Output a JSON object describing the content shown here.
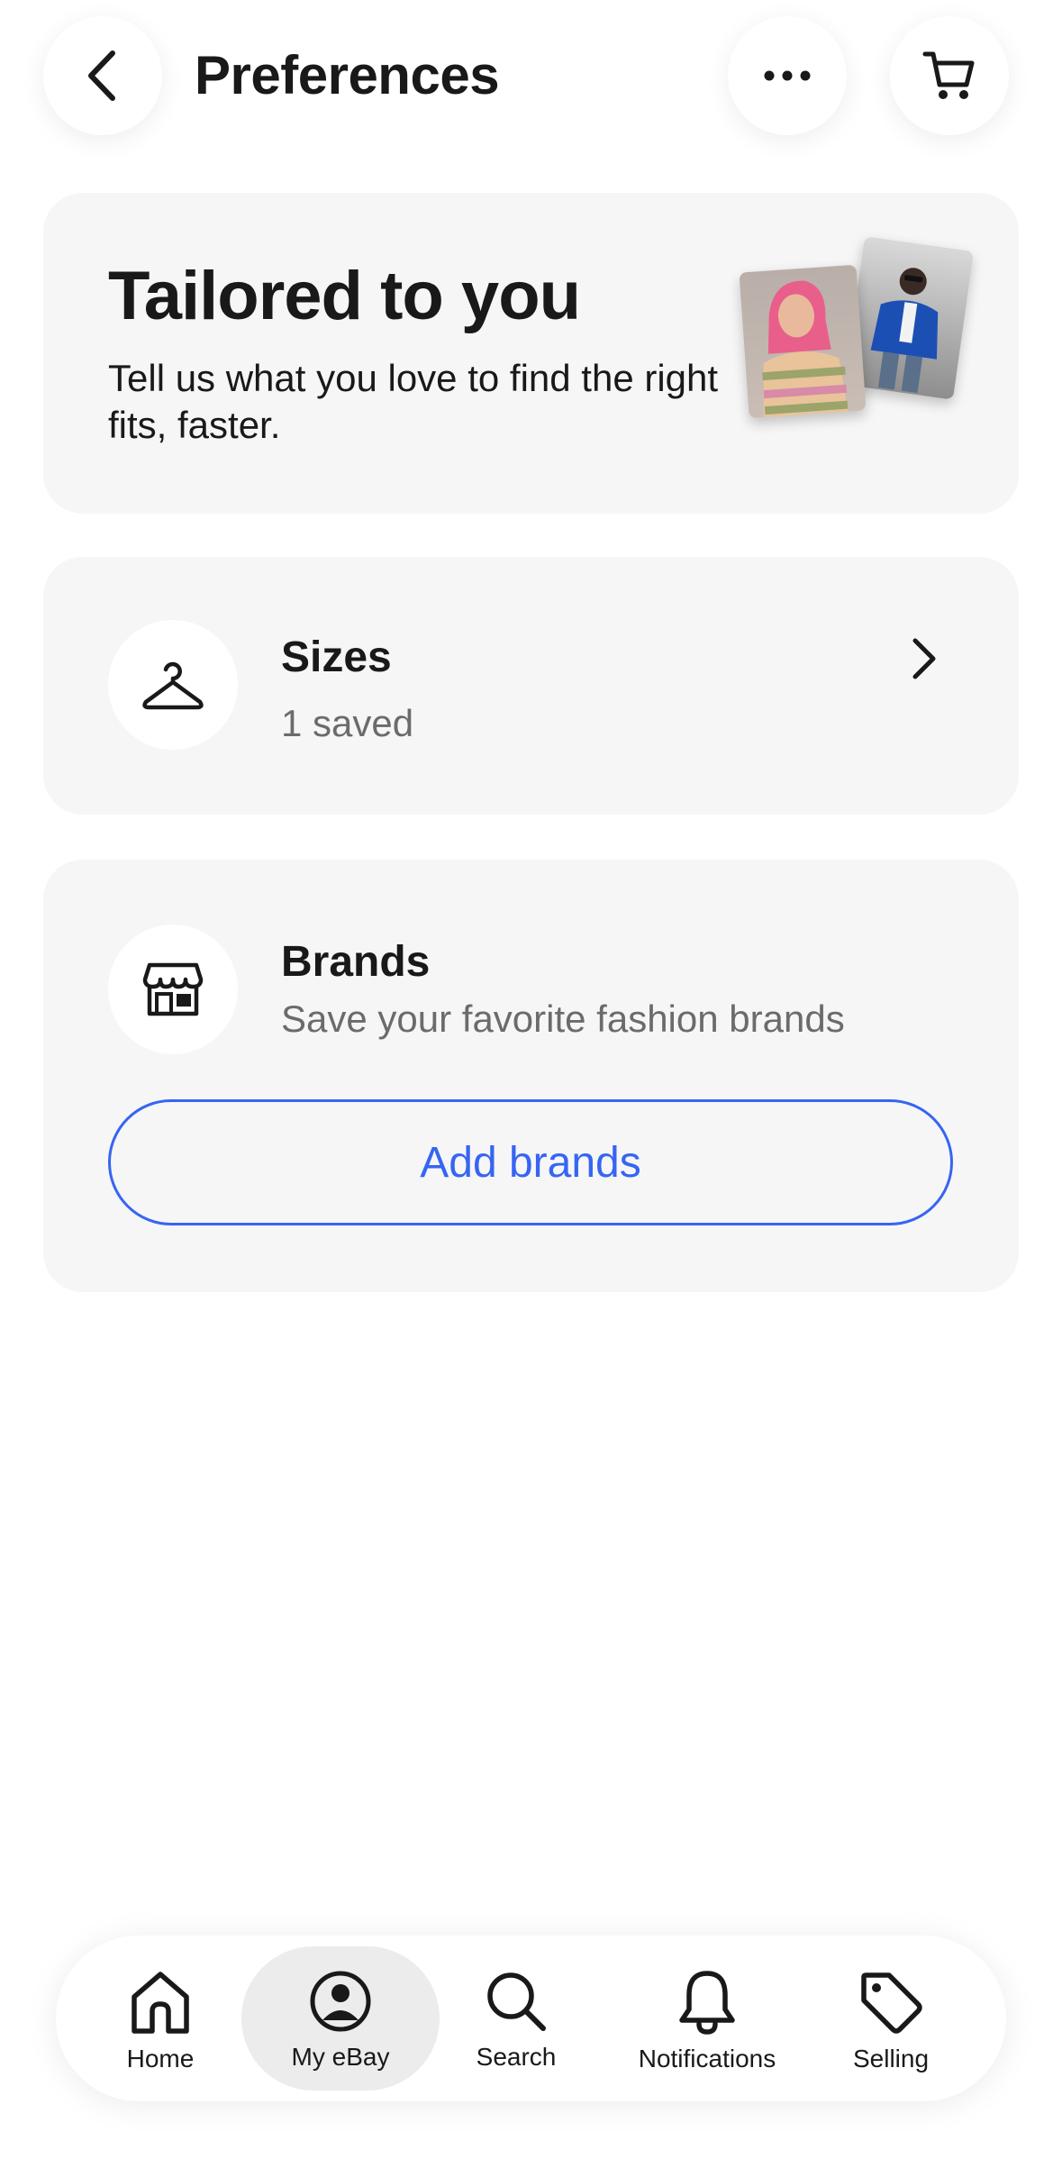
{
  "header": {
    "title": "Preferences",
    "back_icon": "chevron-left-icon",
    "more_icon": "more-horizontal-icon",
    "cart_icon": "cart-icon"
  },
  "hero": {
    "title": "Tailored to you",
    "subtitle": "Tell us what you love to find the right fits, faster."
  },
  "sizes": {
    "title": "Sizes",
    "subtitle": "1 saved",
    "icon": "hanger-icon"
  },
  "brands": {
    "title": "Brands",
    "subtitle": "Save your favorite fashion brands",
    "icon": "store-icon",
    "button_label": "Add brands"
  },
  "bottom_nav": {
    "items": [
      {
        "label": "Home",
        "icon": "home-icon",
        "active": false
      },
      {
        "label": "My eBay",
        "icon": "user-icon",
        "active": true
      },
      {
        "label": "Search",
        "icon": "search-icon",
        "active": false
      },
      {
        "label": "Notifications",
        "icon": "bell-icon",
        "active": false
      },
      {
        "label": "Selling",
        "icon": "tag-icon",
        "active": false
      }
    ]
  },
  "colors": {
    "accent": "#3665f3",
    "card_background": "#f6f6f7",
    "text_primary": "#191919",
    "text_secondary": "#6b6b6b"
  }
}
